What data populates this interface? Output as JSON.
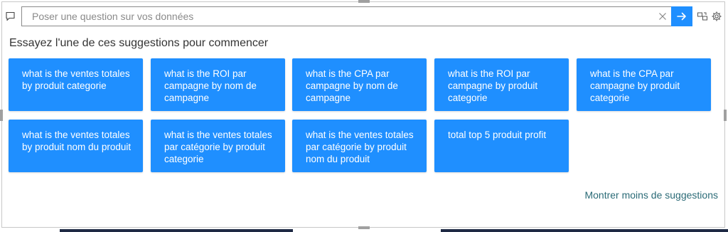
{
  "search": {
    "placeholder": "Poser une question sur vos données",
    "value": ""
  },
  "heading": "Essayez l'une de ces suggestions pour commencer",
  "suggestions": [
    "what is the ventes totales by produit categorie",
    "what is the ROI par campagne by nom de campagne",
    "what is the CPA par campagne by nom de campagne",
    "what is the ROI par campagne by produit categorie",
    "what is the CPA par campagne by produit categorie",
    "what is the ventes totales by produit nom du produit",
    "what is the ventes totales par catégorie by produit categorie",
    "what is the ventes totales par catégorie by produit nom du produit",
    "total top 5 produit profit"
  ],
  "show_less_label": "Montrer moins de suggestions",
  "colors": {
    "accent": "#1f8fff",
    "link": "#2b6b77",
    "heading": "#333333"
  },
  "icons": {
    "qa": "speech-bubble-icon",
    "clear": "close-icon",
    "submit": "arrow-right-icon",
    "convert": "convert-visual-icon",
    "settings": "gear-icon"
  }
}
